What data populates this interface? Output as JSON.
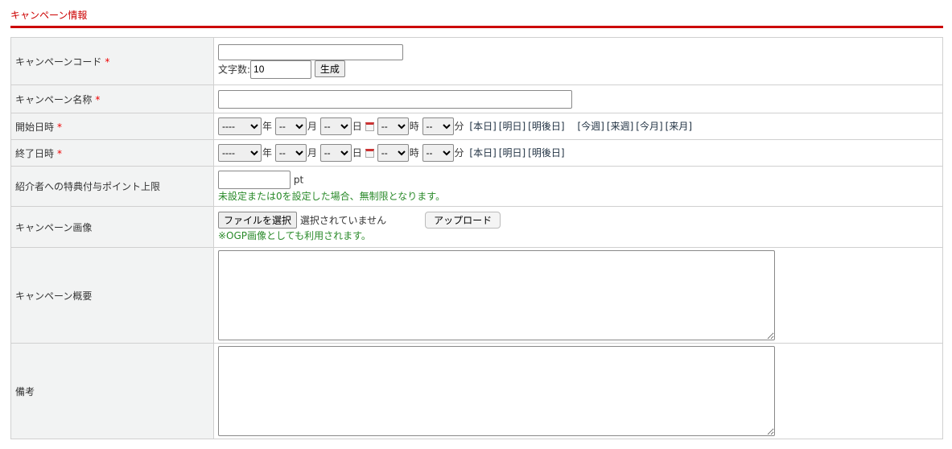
{
  "section_title": "キャンペーン情報",
  "required_mark": "*",
  "labels": {
    "code": "キャンペーンコード",
    "name": "キャンペーン名称",
    "start": "開始日時",
    "end": "終了日時",
    "points": "紹介者への特典付与ポイント上限",
    "image": "キャンペーン画像",
    "summary": "キャンペーン概要",
    "notes": "備考"
  },
  "code": {
    "value": "",
    "length_label": "文字数:",
    "length_value": "10",
    "generate": "生成"
  },
  "name": {
    "value": ""
  },
  "datetime": {
    "year": "----",
    "month": "--",
    "day": "--",
    "hour": "--",
    "minute": "--",
    "year_unit": "年",
    "month_unit": "月",
    "day_unit": "日",
    "hour_unit": "時",
    "minute_unit": "分"
  },
  "start_links": [
    "[本日]",
    "[明日]",
    "[明後日]",
    "[今週]",
    "[来週]",
    "[今月]",
    "[来月]"
  ],
  "end_links": [
    "[本日]",
    "[明日]",
    "[明後日]"
  ],
  "points": {
    "value": "",
    "unit": "pt",
    "note": "未設定または0を設定した場合、無制限となります。"
  },
  "image": {
    "choose": "ファイルを選択",
    "no_file": "選択されていません",
    "upload": "アップロード",
    "note": "※OGP画像としても利用されます。"
  },
  "summary": {
    "value": ""
  },
  "notes": {
    "value": ""
  }
}
